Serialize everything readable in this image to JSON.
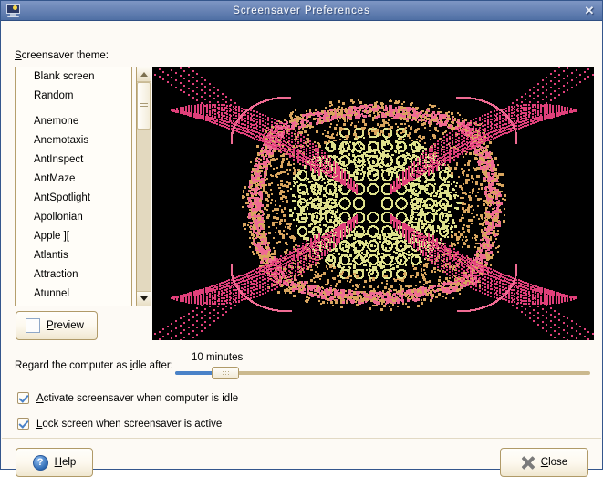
{
  "window": {
    "title": "Screensaver Preferences",
    "icon": "screensaver-monitor-icon",
    "close_label": "✕"
  },
  "theme_section": {
    "label": "Screensaver theme:",
    "items": [
      {
        "label": "Blank screen"
      },
      {
        "label": "Random"
      },
      {
        "label": "Anemone"
      },
      {
        "label": "Anemotaxis"
      },
      {
        "label": "AntInspect"
      },
      {
        "label": "AntMaze"
      },
      {
        "label": "AntSpotlight"
      },
      {
        "label": "Apollonian"
      },
      {
        "label": "Apple ]["
      },
      {
        "label": "Atlantis"
      },
      {
        "label": "Attraction"
      },
      {
        "label": "Atunnel"
      }
    ],
    "separator_after_index": 1
  },
  "preview_button": {
    "label": "Preview",
    "icon": "expand-fullscreen-icon"
  },
  "idle_row": {
    "label": "Regard the computer as idle after:",
    "value_text": "10 minutes",
    "fill_percent": 10
  },
  "checkboxes": [
    {
      "label": "Activate screensaver when computer is idle",
      "checked": true
    },
    {
      "label": "Lock screen when screensaver is active",
      "checked": true
    }
  ],
  "footer": {
    "help_label": "Help",
    "help_icon": "question-circle-icon",
    "close_label": "Close",
    "close_icon": "x-cross-icon"
  },
  "preview_image": {
    "name": "attraction-screensaver-preview",
    "background": "#000000",
    "colors": {
      "core": "#dee08c",
      "mid": "#d9a55e",
      "ring": "#ef6b93",
      "outer": "#e0407a"
    }
  }
}
